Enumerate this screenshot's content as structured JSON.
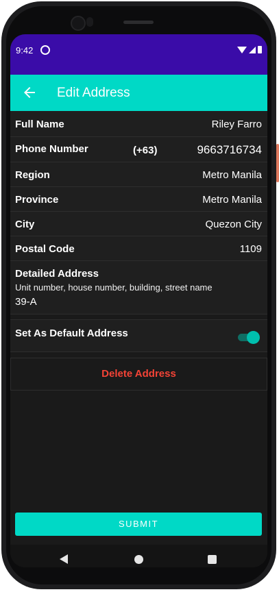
{
  "status_bar": {
    "time": "9:42"
  },
  "app_bar": {
    "title": "Edit Address"
  },
  "form": {
    "full_name": {
      "label": "Full Name",
      "value": "Riley Farro"
    },
    "phone": {
      "label": "Phone Number",
      "code": "(+63)",
      "value": "9663716734"
    },
    "region": {
      "label": "Region",
      "value": "Metro Manila"
    },
    "province": {
      "label": "Province",
      "value": "Metro Manila"
    },
    "city": {
      "label": "City",
      "value": "Quezon City"
    },
    "postal": {
      "label": "Postal Code",
      "value": "1109"
    },
    "detailed": {
      "label": "Detailed Address",
      "hint": "Unit number, house number, building, street name",
      "value": "39-A"
    },
    "default_address": {
      "label": "Set As Default Address",
      "enabled": true
    }
  },
  "actions": {
    "delete_label": "Delete Address",
    "submit_label": "SUBMIT"
  },
  "colors": {
    "status_bar": "#3a0ca8",
    "accent": "#00d9c6",
    "danger": "#f44336",
    "background": "#1a1a1a"
  },
  "icons": {
    "back": "arrow-left-icon",
    "nav_back": "triangle-back-icon",
    "nav_home": "circle-home-icon",
    "nav_recent": "square-recent-icon"
  }
}
